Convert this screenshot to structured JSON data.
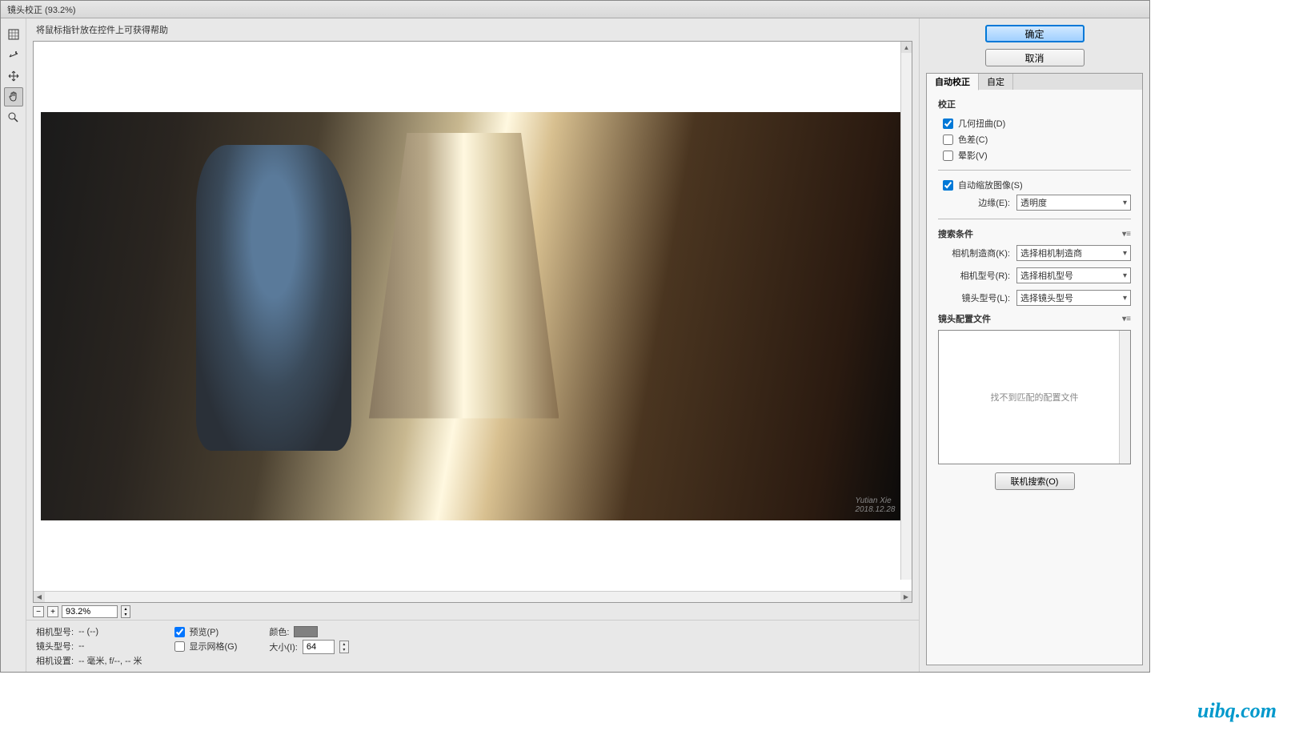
{
  "title": "镜头校正 (93.2%)",
  "help_text": "将鼠标指针放在控件上可获得帮助",
  "tools": [
    "remove-distortion",
    "straighten",
    "move-grid",
    "hand",
    "zoom"
  ],
  "zoom": {
    "value": "93.2%"
  },
  "signature": {
    "name": "Yutian Xie",
    "date": "2018.12.28"
  },
  "bottom": {
    "camera_model_label": "相机型号:",
    "camera_model_value": "-- (--)",
    "lens_model_label": "镜头型号:",
    "lens_model_value": "--",
    "camera_settings_label": "相机设置:",
    "camera_settings_value": "-- 毫米, f/--, -- 米",
    "preview_label": "预览(P)",
    "preview_checked": true,
    "grid_label": "显示网格(G)",
    "grid_checked": false,
    "color_label": "颜色:",
    "size_label": "大小(I):",
    "size_value": "64"
  },
  "buttons": {
    "ok": "确定",
    "cancel": "取消"
  },
  "tabs": {
    "auto": "自动校正",
    "custom": "自定"
  },
  "auto_panel": {
    "correction_title": "校正",
    "geo_label": "几何扭曲(D)",
    "geo_checked": true,
    "chroma_label": "色差(C)",
    "chroma_checked": false,
    "vignette_label": "晕影(V)",
    "vignette_checked": false,
    "autoscale_label": "自动缩放图像(S)",
    "autoscale_checked": true,
    "edge_label": "边缘(E):",
    "edge_value": "透明度",
    "search_title": "搜索条件",
    "cam_make_label": "相机制造商(K):",
    "cam_make_value": "选择相机制造商",
    "cam_model_label": "相机型号(R):",
    "cam_model_value": "选择相机型号",
    "lens_model_label": "镜头型号(L):",
    "lens_model_value": "选择镜头型号",
    "profiles_title": "镜头配置文件",
    "no_match": "找不到匹配的配置文件",
    "online_search": "联机搜索(O)"
  },
  "watermark": "UiBQ.CoM"
}
